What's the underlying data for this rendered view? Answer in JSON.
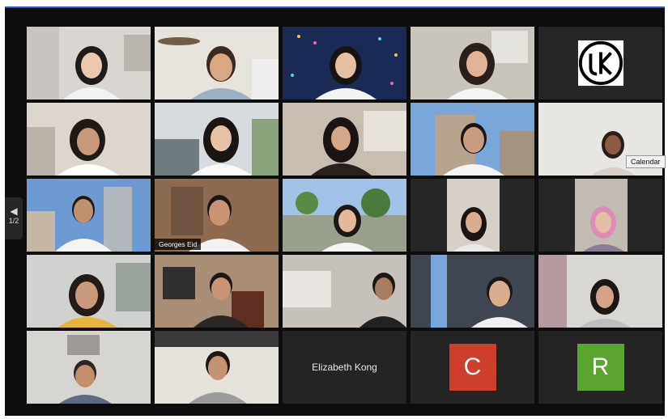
{
  "meeting": {
    "page_indicator": "1/2",
    "tooltip_text": "Calendar"
  },
  "participants": [
    {
      "name": "",
      "label": "participant-1"
    },
    {
      "name": "",
      "label": "participant-2"
    },
    {
      "name": "",
      "label": "participant-3"
    },
    {
      "name": "",
      "label": "participant-4"
    },
    {
      "name": "",
      "label": "participant-5-logo"
    },
    {
      "name": "",
      "label": "participant-6"
    },
    {
      "name": "",
      "label": "participant-7"
    },
    {
      "name": "",
      "label": "participant-8"
    },
    {
      "name": "",
      "label": "participant-9"
    },
    {
      "name": "",
      "label": "participant-10"
    },
    {
      "name": "",
      "label": "participant-11"
    },
    {
      "name": "Georges Eid",
      "label": "participant-12-active-speaker"
    },
    {
      "name": "",
      "label": "participant-13"
    },
    {
      "name": "",
      "label": "participant-14"
    },
    {
      "name": "",
      "label": "participant-15"
    },
    {
      "name": "",
      "label": "participant-16"
    },
    {
      "name": "",
      "label": "participant-17"
    },
    {
      "name": "",
      "label": "participant-18"
    },
    {
      "name": "",
      "label": "participant-19"
    },
    {
      "name": "",
      "label": "participant-20"
    },
    {
      "name": "",
      "label": "participant-21"
    },
    {
      "name": "",
      "label": "participant-22"
    },
    {
      "name": "Elizabeth Kong",
      "label": "participant-23-camera-off"
    },
    {
      "name": "",
      "label": "participant-24-avatar",
      "avatar_letter": "C",
      "avatar_color": "#cf3e2b"
    },
    {
      "name": "",
      "label": "participant-25-avatar",
      "avatar_letter": "R",
      "avatar_color": "#5aa630"
    }
  ],
  "colors": {
    "background": "#0d0d0d",
    "tile": "#262626",
    "active_speaker_border": "#b7d84c",
    "window_accent": "#2a55c8"
  }
}
